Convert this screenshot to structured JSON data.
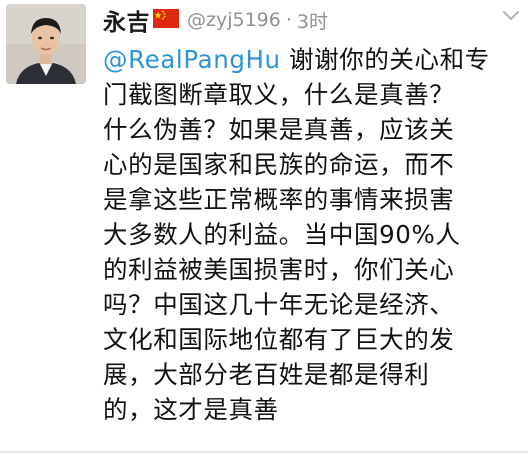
{
  "tweet": {
    "author_name": "永吉",
    "flag_icon": "china-flag-icon",
    "handle": "@zyj5196",
    "separator": "·",
    "time": "3时",
    "mention": "@RealPangHu",
    "lines": [
      " 谢谢你的关心和专",
      "门截图断章取义，什么是真善？",
      "什么伪善？如果是真善，应该关",
      "心的是国家和民族的命运，而不",
      "是拿这些正常概率的事情来损害",
      "大多数人的利益。当中国90%人",
      "的利益被美国损害时，你们关心",
      "吗？中国这几十年无论是经济、",
      "文化和国际地位都有了巨大的发",
      "展，大部分老百姓是都是得利",
      "的，这才是真善"
    ]
  },
  "colors": {
    "mention": "#2d95d6",
    "secondary_text": "#8f9396",
    "primary_text": "#111111"
  }
}
